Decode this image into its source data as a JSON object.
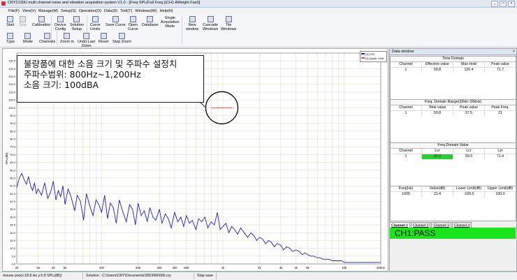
{
  "window": {
    "title": "CRY2130U multi channel noise and vibration acquisition system V1.0 - [Freq SPL(Full Freq.)(CH1 AWeight Fast)]",
    "controls": [
      "_",
      "□",
      "×"
    ]
  },
  "menu": [
    "File(F)",
    "View(V)",
    "Manage(M)",
    "Setup(S)",
    "Operation(O)",
    "Data(D)",
    "Tool(T)",
    "Windows(W)",
    "Help(H)"
  ],
  "toolbar": {
    "start": "Start",
    "stop": "Stop",
    "calibration": "Calibration",
    "device_config_1": "Device",
    "device_config_2": "Config",
    "solution_setup_1": "Solution",
    "solution_setup_2": "Setup",
    "curve_limits_1": "Curve",
    "curve_limits_2": "Limits",
    "save_curve": "Save Curve",
    "open_curve_1": "Open",
    "open_curve_2": "Curve",
    "database": "Database",
    "acq_mode_1": "Single",
    "acq_mode_2": "Acquisition",
    "acq_mode_3": "Mode",
    "new_window_1": "New",
    "new_window_2": "window",
    "cascade_1": "Cascade",
    "cascade_2": "Windows",
    "tile_1": "Tile",
    "tile_2": "Windows",
    "type": "Type",
    "mode": "Mode",
    "channels": "Channels",
    "zoom_in": "Zoom in",
    "undo_zoom_1": "Undo Last",
    "undo_zoom_2": "Zoom",
    "reset": "Reset",
    "stop_zoom": "Stop Zoom"
  },
  "annotation": {
    "line1": "불량품에 대한 소음 크기 및 주파수 설정치",
    "line2": "주파수범위: 800Hz~1,200Hz",
    "line3": "소음 크기: 100dBA"
  },
  "legend": [
    "[1] CH1",
    "[1] Upper Limit"
  ],
  "colors": {
    "series": "#1a1acd",
    "limit": "#e05050",
    "circle": "#000000",
    "pass": "#18e61a",
    "grid": "#d8d8c8"
  },
  "chart_data": {
    "type": "line",
    "ylabel": "SPL(dB)",
    "xscale": "log",
    "xlim": [
      20,
      20000
    ],
    "ylim": [
      0,
      135
    ],
    "yticks": [
      "0.0",
      "5.0",
      "10.0",
      "15.0",
      "20.0",
      "25.0",
      "30.0",
      "35.0",
      "40.0",
      "45.0",
      "50.0",
      "55.0",
      "60.0",
      "65.0",
      "70.0",
      "75.0",
      "80.0",
      "85.0",
      "90.0",
      "95.0",
      "100.0",
      "105.0",
      "110.0",
      "115.0",
      "120.0",
      "125.0",
      "130.0"
    ],
    "xticks": [
      "20",
      "30",
      "40",
      "50",
      "100",
      "200",
      "300",
      "400",
      "500",
      "1k",
      "2k",
      "3k",
      "4k",
      "5k",
      "10k",
      "20kHz"
    ],
    "series": [
      {
        "name": "[1] CH1",
        "x": [
          20,
          21,
          22,
          23,
          24,
          25,
          26,
          27,
          28,
          29,
          30,
          32,
          34,
          36,
          38,
          40,
          42,
          44,
          46,
          48,
          50,
          53,
          56,
          60,
          63,
          67,
          71,
          75,
          80,
          85,
          90,
          95,
          100,
          106,
          112,
          118,
          125,
          132,
          140,
          150,
          160,
          170,
          180,
          190,
          200,
          212,
          225,
          238,
          250,
          265,
          280,
          300,
          315,
          335,
          355,
          375,
          400,
          425,
          450,
          475,
          500,
          530,
          560,
          600,
          630,
          670,
          710,
          750,
          800,
          850,
          900,
          950,
          1000,
          1060,
          1120,
          1180,
          1250,
          1320,
          1400,
          1500,
          1600,
          1700,
          1800,
          1900,
          2000,
          2120,
          2250,
          2380,
          2500,
          2650,
          2800,
          3000,
          3150,
          3350,
          3550,
          3750,
          4000,
          4250,
          4500,
          4750,
          5000,
          5300,
          5600,
          6000,
          6300,
          6700,
          7100,
          7500,
          8000,
          8500,
          9000,
          9500,
          10000,
          10600,
          11200,
          11800,
          12500,
          13200,
          14000,
          15000,
          16000,
          17000,
          18000,
          19000,
          20000
        ],
        "y": [
          49.0,
          55.0,
          58.0,
          54.0,
          51.0,
          56.0,
          50.0,
          47.0,
          52.0,
          45.0,
          48.0,
          44.0,
          52.0,
          42.0,
          46.0,
          53.0,
          41.0,
          47.0,
          43.0,
          50.0,
          38.0,
          48.0,
          43.0,
          34.0,
          44.0,
          40.0,
          28.0,
          45.0,
          37.0,
          31.0,
          41.0,
          38.0,
          33.0,
          44.0,
          29.0,
          39.0,
          36.0,
          26.0,
          41.0,
          33.0,
          27.0,
          38.0,
          35.0,
          25.0,
          39.0,
          31.0,
          34.0,
          27.0,
          36.0,
          30.0,
          28.0,
          35.0,
          26.0,
          32.0,
          29.0,
          23.0,
          33.0,
          27.0,
          30.0,
          24.0,
          31.0,
          26.0,
          28.0,
          22.0,
          29.0,
          27.0,
          30.0,
          23.0,
          27.0,
          25.0,
          33.0,
          22.0,
          24.0,
          26.0,
          20.0,
          24.0,
          22.0,
          19.0,
          23.0,
          20.0,
          17.0,
          20.0,
          18.0,
          15.0,
          17.0,
          16.0,
          13.0,
          15.0,
          14.0,
          11.0,
          13.0,
          12.0,
          9.0,
          11.0,
          10.0,
          8.0,
          9.0,
          8.0,
          6.0,
          7.0,
          6.0,
          5.0,
          5.0,
          4.0,
          4.0,
          3.0,
          3.0,
          3.0,
          2.0,
          2.0,
          2.0,
          2.0,
          1.0,
          1.0,
          1.0,
          1.0,
          1.0,
          1.0,
          1.0,
          1.0,
          1.0,
          1.0,
          1.0,
          1.0,
          1.0
        ]
      },
      {
        "name": "[1] Upper Limit",
        "x": [
          800,
          1200
        ],
        "y": [
          100,
          100
        ]
      }
    ]
  },
  "data_window": {
    "title": "Data window",
    "close": "×",
    "time_domain": {
      "title": "Time Domain",
      "headers": [
        "Channel",
        "Effective value",
        "Max Hold",
        "Peak value"
      ],
      "rows": [
        [
          "1",
          "59.8",
          "120.4",
          "71.7"
        ]
      ]
    },
    "freq_range": {
      "title": "Freq. Domain Range(20Hz~20kHz)",
      "headers": [
        "Channel",
        "Total value",
        "Peak value",
        "Peak Freq."
      ],
      "rows": [
        [
          "1",
          "59.8",
          "57.5",
          "21"
        ]
      ]
    },
    "freq_value": {
      "title": "Freq.Domain Value",
      "headers": [
        "Channel",
        "Lcr",
        "Lcr",
        "Lzr"
      ],
      "rows": [
        [
          "1",
          "47.2",
          "59.3",
          "71.4"
        ]
      ]
    },
    "limits": {
      "headers": [
        "Freq(Hz)",
        "Value(dB)",
        "Lower Limit(dB)",
        "Upper Limit(dB)"
      ],
      "rows": [
        [
          "1000",
          "21.4",
          "-100.0",
          "100.0"
        ]
      ]
    },
    "tabs": [
      "Channel 1",
      "Channel 2",
      "Channel 3",
      "Channel 4"
    ],
    "result": "CH1:PASS"
  },
  "status": {
    "mouse": "mouse pos(x:18.8 Hz  y:0.8 SPL(dB))",
    "solution": "Solution : C:\\Users\\CRY\\Documents\\355\\666\\666.cry",
    "state": "Stop save"
  }
}
